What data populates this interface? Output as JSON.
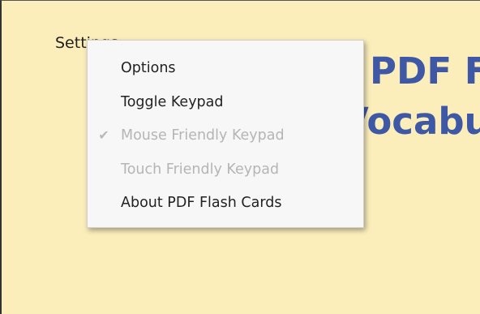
{
  "settings_button_label": "Settings",
  "heading": {
    "line1": "PDF Flash",
    "line2": "Vocabulary Ar"
  },
  "menu": {
    "items": [
      {
        "label": "Options",
        "enabled": true,
        "checked": false
      },
      {
        "label": "Toggle Keypad",
        "enabled": true,
        "checked": false
      },
      {
        "label": "Mouse Friendly Keypad",
        "enabled": false,
        "checked": true
      },
      {
        "label": "Touch Friendly Keypad",
        "enabled": false,
        "checked": false
      },
      {
        "label": "About PDF Flash Cards",
        "enabled": true,
        "checked": false
      }
    ],
    "check_icon": "check-icon"
  },
  "colors": {
    "page_background": "#fbeebb",
    "heading": "#3f58a6",
    "menu_background": "#f7f7f7",
    "disabled_text": "#b5b5b5"
  }
}
